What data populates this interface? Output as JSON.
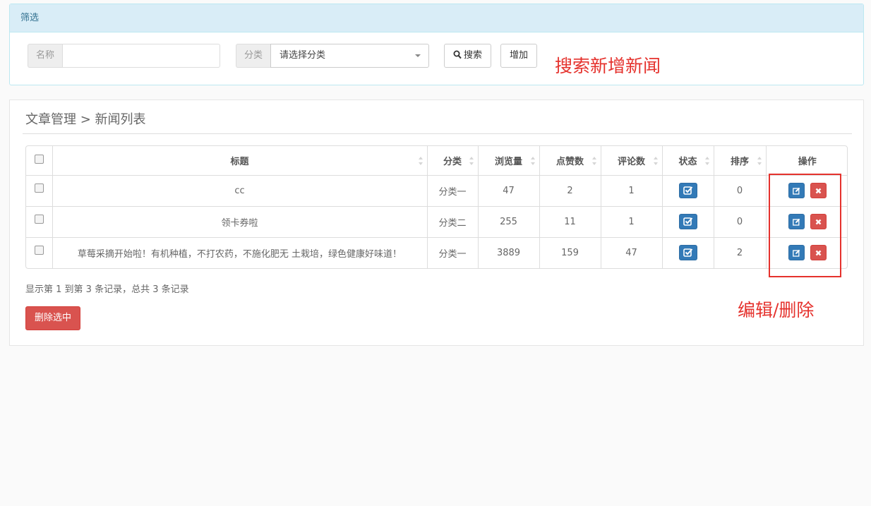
{
  "filter": {
    "title": "筛选",
    "name_label": "名称",
    "name_value": "",
    "name_placeholder": "",
    "category_label": "分类",
    "category_selected": "请选择分类",
    "search_label": "搜索",
    "add_label": "增加"
  },
  "annotations": {
    "top": "搜索新增新闻",
    "right": "编辑/删除"
  },
  "breadcrumb": "文章管理 > 新闻列表",
  "table": {
    "headers": [
      "标题",
      "分类",
      "浏览量",
      "点赞数",
      "评论数",
      "状态",
      "排序",
      "操作"
    ],
    "rows": [
      {
        "title": "cc",
        "category": "分类一",
        "views": "47",
        "likes": "2",
        "comments": "1",
        "sort": "0"
      },
      {
        "title": "领卡券啦",
        "category": "分类二",
        "views": "255",
        "likes": "11",
        "comments": "1",
        "sort": "0"
      },
      {
        "title": "草莓采摘开始啦！有机种植，不打农药，不施化肥无 土栽培，绿色健康好味道！",
        "category": "分类一",
        "views": "3889",
        "likes": "159",
        "comments": "47",
        "sort": "2"
      }
    ]
  },
  "summary": "显示第 1 到第 3 条记录，总共 3 条记录",
  "delete_selected_label": "删除选中",
  "icons": {
    "search": "search-icon",
    "status": "check-square-icon",
    "edit": "edit-icon",
    "delete": "close-icon",
    "sort": "sort-icon",
    "dropdown": "caret-down-icon"
  },
  "colors": {
    "primary": "#337ab7",
    "danger": "#d9534f",
    "annotation": "#e5322d",
    "info_bg": "#d9edf7"
  }
}
